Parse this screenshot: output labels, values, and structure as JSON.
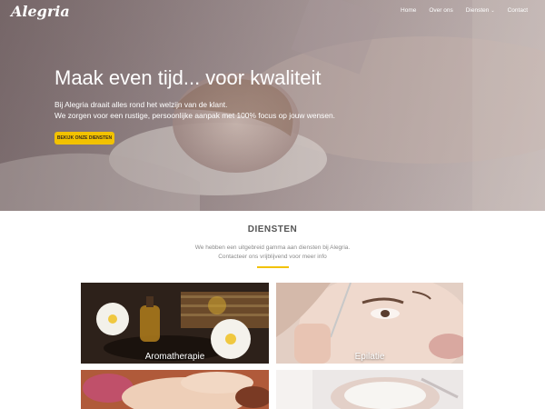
{
  "brand": {
    "logo": "Alegria"
  },
  "nav": {
    "items": [
      {
        "label": "Home"
      },
      {
        "label": "Over ons"
      },
      {
        "label": "Diensten",
        "caret": "⌄"
      },
      {
        "label": "Contact"
      }
    ]
  },
  "hero": {
    "title": "Maak even tijd... voor kwaliteit",
    "line1": "Bij Alegria draait alles rond het welzijn van de klant.",
    "line2": "We zorgen voor een rustige, persoonlijke aanpak met 100% focus op jouw wensen.",
    "button": "BEKIJK ONZE DIENSTEN"
  },
  "services": {
    "title": "DIENSTEN",
    "intro_line1": "We hebben een uitgebreid gamma aan diensten bij Alegria.",
    "intro_line2": "Contacteer ons vrijblijvend voor meer info",
    "cards": [
      {
        "label": "Aromatherapie"
      },
      {
        "label": "Epilatie"
      },
      {
        "label": ""
      },
      {
        "label": ""
      }
    ]
  },
  "colors": {
    "accent": "#f2c200",
    "text_muted": "#8a8a8a",
    "heading": "#555555"
  }
}
